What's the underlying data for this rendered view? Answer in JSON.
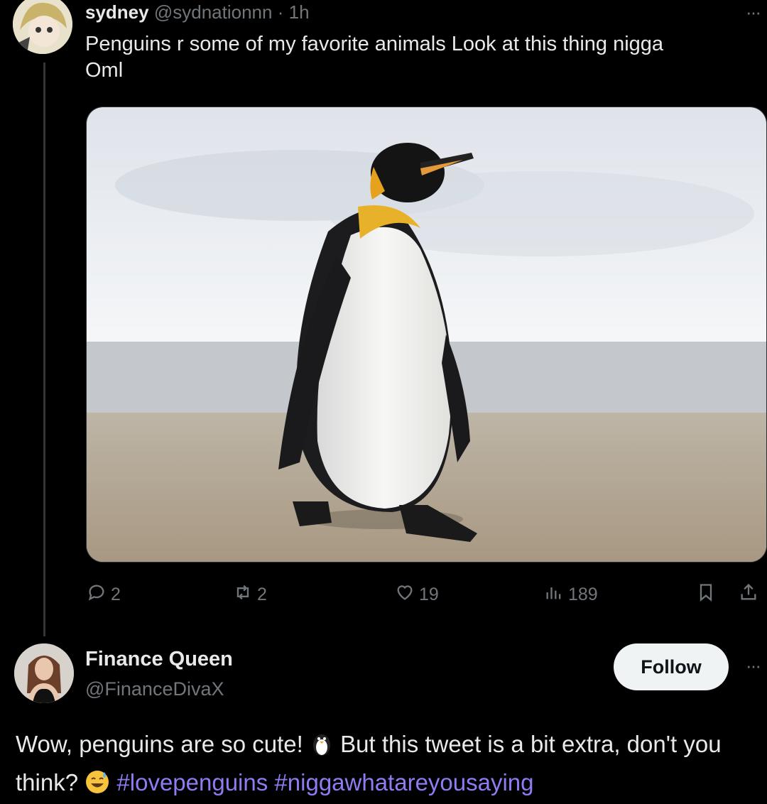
{
  "tweet": {
    "author_name": "sydney",
    "author_handle": "@sydnationnn",
    "separator": "·",
    "time": "1h",
    "more_label": "···",
    "text_line1": "Penguins r  some of my favorite animals Look at this thing nigga",
    "text_line2": "Oml",
    "actions": {
      "replies": "2",
      "reposts": "2",
      "likes": "19",
      "views": "189"
    }
  },
  "reply": {
    "author_name": "Finance Queen",
    "author_handle": "@FinanceDivaX",
    "follow_label": "Follow",
    "more_label": "···",
    "text_part1": "Wow, penguins are so cute!",
    "text_part2": "But this tweet is a bit extra, don't you think?",
    "hashtag1": "#lovepenguins",
    "hashtag2": "#niggawhatareyousaying"
  },
  "icons": {
    "reply": "speech-bubble-icon",
    "repost": "repost-arrows-icon",
    "like": "heart-icon",
    "views": "bar-chart-icon",
    "bookmark": "bookmark-icon",
    "share": "share-icon",
    "emoji1": "penguin-emoji",
    "emoji2": "sweat-smile-emoji"
  },
  "colors": {
    "background": "#000000",
    "text": "#e7e9ea",
    "muted": "#71767b",
    "hashtag": "#8d7cf2",
    "follow_bg": "#eff3f4"
  }
}
